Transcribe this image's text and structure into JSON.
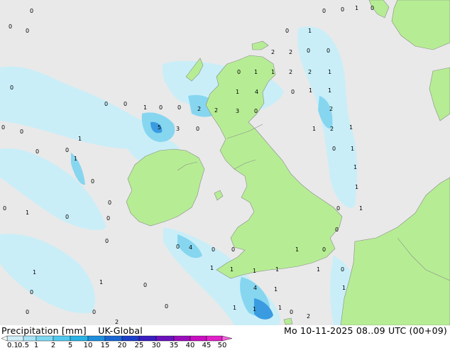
{
  "header": {
    "product_label": "Precipitation [mm]",
    "model_label": "UK-Global",
    "valid_time": "Mo 10-11-2025 08..09 UTC (00+09)"
  },
  "legend": {
    "ticks": [
      "0.1",
      "0.5",
      "1",
      "2",
      "5",
      "10",
      "15",
      "20",
      "25",
      "30",
      "35",
      "40",
      "45",
      "50"
    ],
    "colors": [
      "#cfeef8",
      "#a8e4f6",
      "#7fd8f2",
      "#52c8ee",
      "#2bb2e6",
      "#1e8fdc",
      "#1a66d2",
      "#1c3fc8",
      "#3a1ec0",
      "#6a12bc",
      "#9a0cbc",
      "#c80ec0",
      "#e020c8",
      "#f060d8"
    ]
  },
  "map_values": [
    {
      "text": "0"
    },
    {
      "text": "1"
    },
    {
      "text": "0"
    },
    {
      "text": "0"
    },
    {
      "text": "0"
    },
    {
      "text": "0"
    },
    {
      "text": "0"
    },
    {
      "text": "0"
    },
    {
      "text": "1"
    },
    {
      "text": "2"
    },
    {
      "text": "2"
    },
    {
      "text": "0"
    },
    {
      "text": "0"
    },
    {
      "text": "0"
    },
    {
      "text": "1"
    },
    {
      "text": "1"
    },
    {
      "text": "2"
    },
    {
      "text": "2"
    },
    {
      "text": "1"
    },
    {
      "text": "0"
    },
    {
      "text": "1"
    },
    {
      "text": "4"
    },
    {
      "text": "0"
    },
    {
      "text": "1"
    },
    {
      "text": "1"
    },
    {
      "text": "0"
    },
    {
      "text": "0"
    },
    {
      "text": "1"
    },
    {
      "text": "0"
    },
    {
      "text": "0"
    },
    {
      "text": "2"
    },
    {
      "text": "2"
    },
    {
      "text": "3"
    },
    {
      "text": "0"
    },
    {
      "text": "2"
    },
    {
      "text": "0"
    },
    {
      "text": "0"
    },
    {
      "text": "5"
    },
    {
      "text": "3"
    },
    {
      "text": "0"
    },
    {
      "text": "1"
    },
    {
      "text": "2"
    },
    {
      "text": "1"
    },
    {
      "text": "0"
    },
    {
      "text": "0"
    },
    {
      "text": "1"
    },
    {
      "text": "1"
    },
    {
      "text": "0"
    },
    {
      "text": "1"
    },
    {
      "text": "0"
    },
    {
      "text": "1"
    },
    {
      "text": "1"
    },
    {
      "text": "1"
    },
    {
      "text": "0"
    },
    {
      "text": "0"
    },
    {
      "text": "1"
    },
    {
      "text": "0"
    },
    {
      "text": "0"
    },
    {
      "text": "0"
    },
    {
      "text": "0"
    },
    {
      "text": "0"
    },
    {
      "text": "0"
    },
    {
      "text": "0"
    },
    {
      "text": "0"
    },
    {
      "text": "4"
    },
    {
      "text": "1"
    },
    {
      "text": "0"
    },
    {
      "text": "1"
    },
    {
      "text": "0"
    },
    {
      "text": "1"
    },
    {
      "text": "1"
    },
    {
      "text": "0"
    },
    {
      "text": "0"
    },
    {
      "text": "1"
    },
    {
      "text": "1"
    },
    {
      "text": "1"
    },
    {
      "text": "1"
    },
    {
      "text": "0"
    },
    {
      "text": "4"
    },
    {
      "text": "1"
    },
    {
      "text": "1"
    },
    {
      "text": "1"
    },
    {
      "text": "0"
    },
    {
      "text": "0"
    },
    {
      "text": "2"
    },
    {
      "text": "1"
    },
    {
      "text": "1"
    },
    {
      "text": "0"
    },
    {
      "text": "2"
    }
  ]
}
